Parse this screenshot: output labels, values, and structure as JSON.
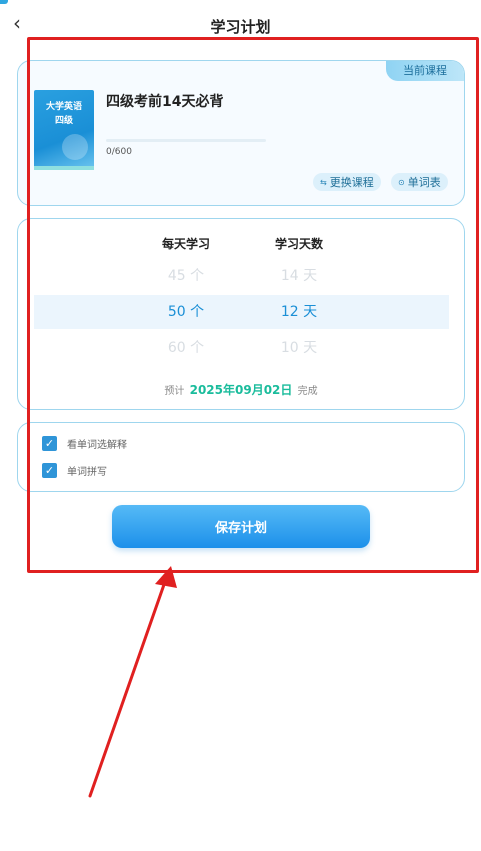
{
  "header": {
    "back_icon": "chevron-left-icon",
    "title": "学习计划"
  },
  "course": {
    "badge": "当前课程",
    "cover_line1": "大学英语",
    "cover_line2": "四级",
    "name": "四级考前14天必背",
    "progress_text": "0/600",
    "progress_fraction": 0,
    "switch_icon": "⇆",
    "switch_label": "更换课程",
    "wordlist_icon": "⊙",
    "wordlist_label": "单词表"
  },
  "plan": {
    "col_daily": "每天学习",
    "col_days": "学习天数",
    "rows": [
      {
        "daily": "45 个",
        "days": "14 天"
      },
      {
        "daily": "50 个",
        "days": "12 天"
      },
      {
        "daily": "60 个",
        "days": "10 天"
      }
    ],
    "estimate_prefix": "预计",
    "estimate_date": "2025年09月02日",
    "estimate_suffix": "完成"
  },
  "options": [
    {
      "label": "看单词选解释",
      "checked": true
    },
    {
      "label": "单词拼写",
      "checked": true
    }
  ],
  "save_label": "保存计划",
  "colors": {
    "accent": "#1a8fd6",
    "date_green": "#1abc9c",
    "annotation_red": "#e02020"
  }
}
